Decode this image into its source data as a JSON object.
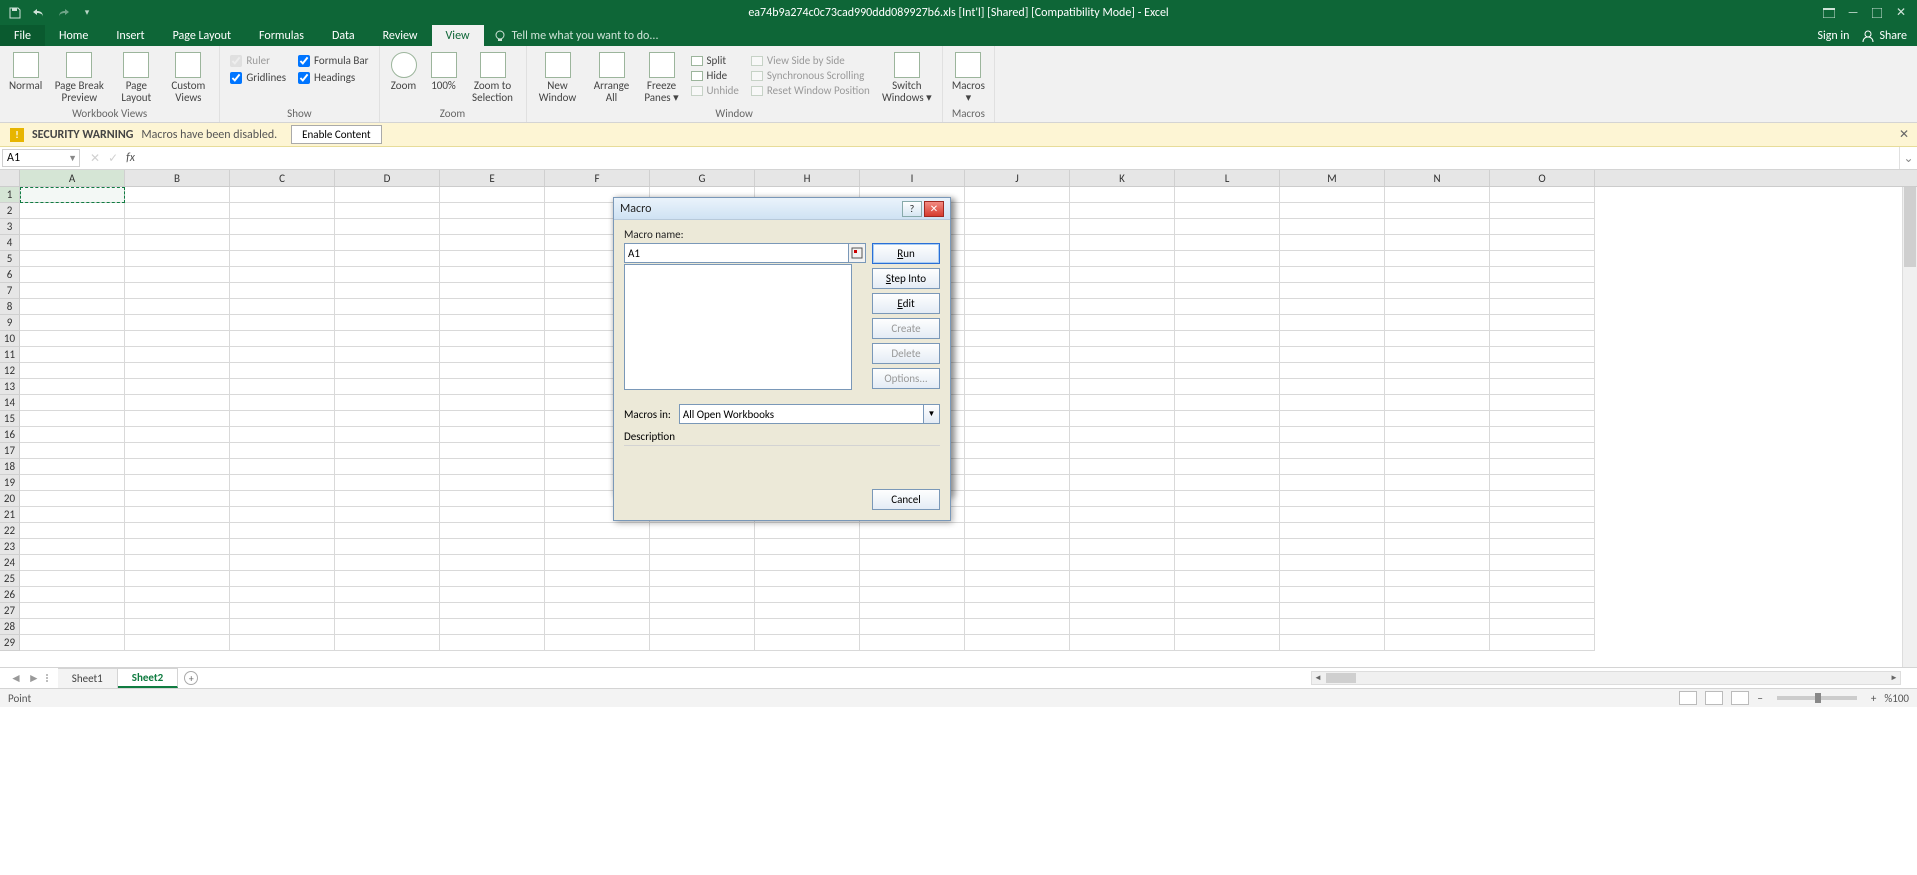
{
  "titlebar": {
    "title": "ea74b9a274c0c73cad990ddd089927b6.xls  [Int'l]  [Shared]  [Compatibility Mode] - Excel"
  },
  "tabs": {
    "file": "File",
    "items": [
      "Home",
      "Insert",
      "Page Layout",
      "Formulas",
      "Data",
      "Review",
      "View"
    ],
    "active": "View",
    "tell_me": "Tell me what you want to do...",
    "sign_in": "Sign in",
    "share": "Share"
  },
  "ribbon": {
    "workbook_views": {
      "normal": "Normal",
      "page_break": "Page Break Preview",
      "page_layout": "Page Layout",
      "custom": "Custom Views",
      "label": "Workbook Views"
    },
    "show": {
      "ruler": "Ruler",
      "formula_bar": "Formula Bar",
      "gridlines": "Gridlines",
      "headings": "Headings",
      "label": "Show"
    },
    "zoom": {
      "zoom": "Zoom",
      "hundred": "100%",
      "to_sel": "Zoom to Selection",
      "label": "Zoom"
    },
    "window": {
      "new_window": "New Window",
      "arrange": "Arrange All",
      "freeze": "Freeze Panes",
      "split": "Split",
      "hide": "Hide",
      "unhide": "Unhide",
      "side_by_side": "View Side by Side",
      "sync_scroll": "Synchronous Scrolling",
      "reset_pos": "Reset Window Position",
      "switch": "Switch Windows",
      "label": "Window"
    },
    "macros": {
      "macros": "Macros",
      "label": "Macros"
    }
  },
  "security": {
    "title": "SECURITY WARNING",
    "text": "Macros have been disabled.",
    "enable": "Enable Content"
  },
  "namebox": "A1",
  "columns": [
    "A",
    "B",
    "C",
    "D",
    "E",
    "F",
    "G",
    "H",
    "I",
    "J",
    "K",
    "L",
    "M",
    "N",
    "O"
  ],
  "rows_count": 29,
  "sheets": {
    "items": [
      "Sheet1",
      "Sheet2"
    ],
    "active": "Sheet2"
  },
  "status": {
    "mode": "Point",
    "zoom": "%100"
  },
  "dialog": {
    "title": "Macro",
    "name_label": "Macro name:",
    "name_value": "A1",
    "run": "Run",
    "step_into": "Step Into",
    "edit": "Edit",
    "create": "Create",
    "delete": "Delete",
    "options": "Options...",
    "macros_in_label": "Macros in:",
    "macros_in_value": "All Open Workbooks",
    "description_label": "Description",
    "cancel": "Cancel"
  }
}
